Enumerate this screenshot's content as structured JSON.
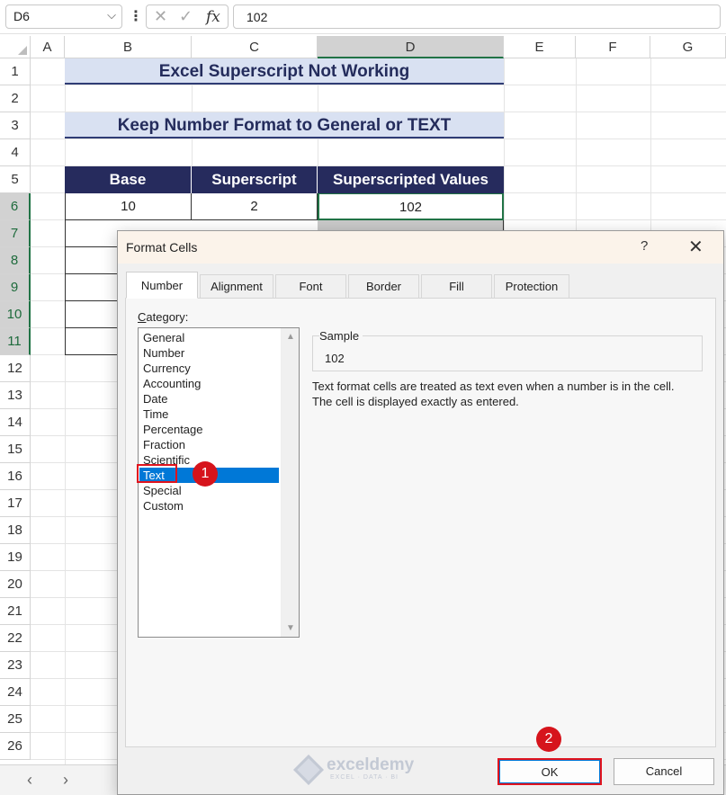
{
  "formula_bar": {
    "name_box": "D6",
    "formula_value": "102",
    "fx_label": "fx",
    "icons": [
      "chevron-down-icon",
      "more-options-icon",
      "cancel-icon",
      "enter-icon",
      "function-icon"
    ]
  },
  "columns": [
    "A",
    "B",
    "C",
    "D",
    "E",
    "F",
    "G"
  ],
  "rows": [
    "1",
    "2",
    "3",
    "4",
    "5",
    "6",
    "7",
    "8",
    "9",
    "10",
    "11",
    "12",
    "13",
    "14",
    "15",
    "16",
    "17",
    "18",
    "19",
    "20",
    "21",
    "22",
    "23",
    "24",
    "25",
    "26"
  ],
  "sheet": {
    "title": "Excel Superscript Not Working",
    "subtitle": "Keep Number Format to General or TEXT",
    "table_headers": [
      "Base",
      "Superscript",
      "Superscripted Values"
    ],
    "table_row_1": [
      "10",
      "2",
      "102"
    ]
  },
  "dialog": {
    "title": "Format Cells",
    "help": "?",
    "close": "✕",
    "tabs": [
      "Number",
      "Alignment",
      "Font",
      "Border",
      "Fill",
      "Protection"
    ],
    "category_label_prefix": "C",
    "category_label_rest": "ategory:",
    "categories": [
      "General",
      "Number",
      "Currency",
      "Accounting",
      "Date",
      "Time",
      "Percentage",
      "Fraction",
      "Scientific",
      "Text",
      "Special",
      "Custom"
    ],
    "selected_category": "Text",
    "sample_label": "Sample",
    "sample_value": "102",
    "description_line1": "Text format cells are treated as text even when a number is in the cell.",
    "description_line2": "The cell is displayed exactly as entered.",
    "ok_label": "OK",
    "cancel_label": "Cancel"
  },
  "annotations": {
    "step1": "1",
    "step2": "2"
  },
  "watermark": {
    "name": "exceldemy",
    "tagline": "EXCEL · DATA · BI"
  },
  "sheet_nav": {
    "prev": "‹",
    "next": "›"
  },
  "colors": {
    "header_fill": "#262b5d",
    "title_fill": "#d9e1f2",
    "selection": "#0078d7",
    "highlight": "#e0141e"
  }
}
